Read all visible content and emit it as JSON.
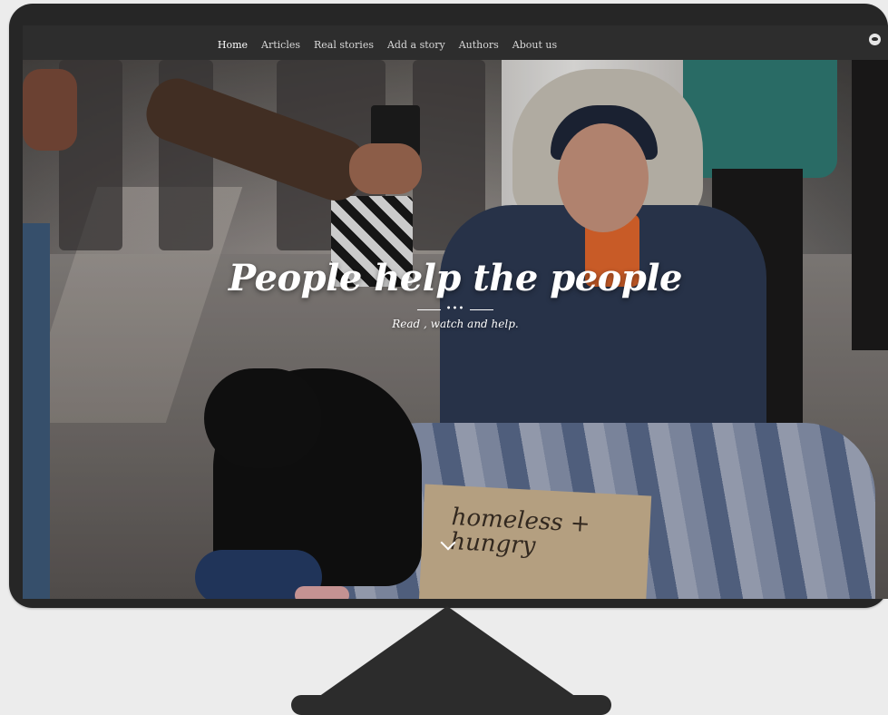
{
  "nav": {
    "items": [
      {
        "label": "Home",
        "active": true
      },
      {
        "label": "Articles",
        "active": false
      },
      {
        "label": "Real stories",
        "active": false
      },
      {
        "label": "Add a story",
        "active": false
      },
      {
        "label": "Authors",
        "active": false
      },
      {
        "label": "About us",
        "active": false
      }
    ],
    "icon": "circle-logo-icon"
  },
  "hero": {
    "title": "People help the people",
    "divider": "•••",
    "subtitle": "Read , watch and help.",
    "sign_text": "homeless +\nhungry",
    "scroll_icon": "chevron-down-icon"
  },
  "colors": {
    "monitor": "#262626",
    "navbar": "#2d2d2d",
    "background": "#ececec"
  }
}
